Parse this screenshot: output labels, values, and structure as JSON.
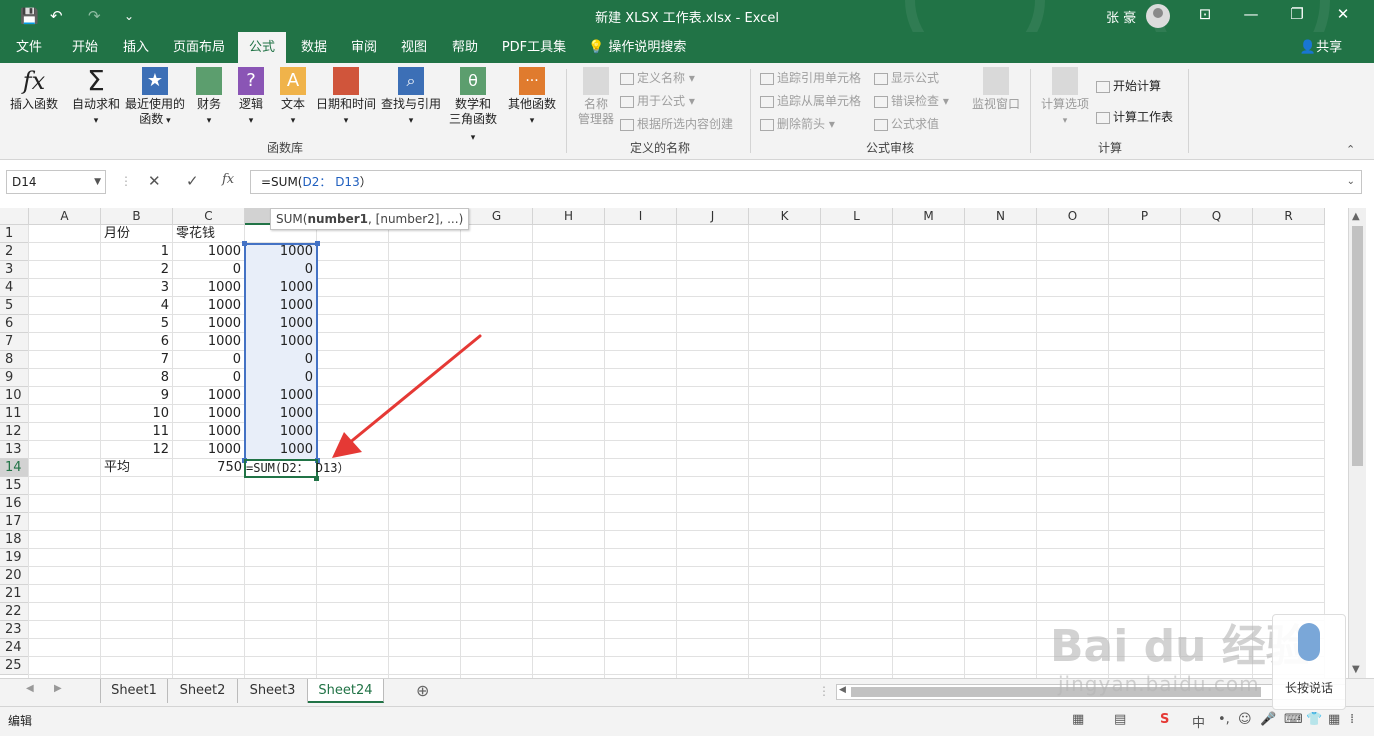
{
  "titlebar": {
    "title": "新建 XLSX 工作表.xlsx  -  Excel",
    "user": "张 豪",
    "save_icon": "💾",
    "undo_icon": "↶",
    "redo_icon": "↷",
    "customize_icon": "⌄",
    "ribbon_display_icon": "⊡",
    "minimize_icon": "—",
    "restore_icon": "❐",
    "close_icon": "✕"
  },
  "menu": {
    "tabs": [
      "文件",
      "开始",
      "插入",
      "页面布局",
      "公式",
      "数据",
      "审阅",
      "视图",
      "帮助",
      "PDF工具集"
    ],
    "active_tab": "公式",
    "search": "操作说明搜索",
    "share": "共享"
  },
  "ribbon": {
    "function_library": {
      "insert_function": "插入函数",
      "autosum": "自动求和",
      "recently_used_1": "最近使用的",
      "recently_used_2": "函数",
      "financial": "财务",
      "logical": "逻辑",
      "text": "文本",
      "datetime": "日期和时间",
      "lookup": "查找与引用",
      "math_1": "数学和",
      "math_2": "三角函数",
      "more": "其他函数",
      "group_label": "函数库"
    },
    "defined_names": {
      "name_manager_1": "名称",
      "name_manager_2": "管理器",
      "define_name": "定义名称",
      "use_in_formula": "用于公式",
      "create_from_selection": "根据所选内容创建",
      "group_label": "定义的名称"
    },
    "formula_auditing": {
      "trace_precedents": "追踪引用单元格",
      "trace_dependents": "追踪从属单元格",
      "remove_arrows": "删除箭头",
      "show_formulas": "显示公式",
      "error_checking": "错误检查",
      "evaluate_formula": "公式求值",
      "watch_window": "监视窗口",
      "group_label": "公式审核"
    },
    "calculation": {
      "options": "计算选项",
      "calc_now": "开始计算",
      "calc_sheet": "计算工作表",
      "group_label": "计算"
    }
  },
  "formula_bar": {
    "name_box": "D14",
    "cancel_icon": "✕",
    "enter_icon": "✓",
    "fx_icon": "fx",
    "formula_prefix": "=SUM(",
    "formula_ref": "D2： D13",
    "formula_suffix": "）"
  },
  "sheet": {
    "columns": [
      "A",
      "B",
      "C",
      "D",
      "E",
      "F",
      "G",
      "H",
      "I",
      "J",
      "K",
      "L",
      "M",
      "N",
      "O",
      "P",
      "Q",
      "R"
    ],
    "row_numbers": [
      "1",
      "2",
      "3",
      "4",
      "5",
      "6",
      "7",
      "8",
      "9",
      "10",
      "11",
      "12",
      "13",
      "14",
      "15",
      "16",
      "17",
      "18",
      "19",
      "20",
      "21",
      "22",
      "23",
      "24",
      "25"
    ],
    "header_b": "月份",
    "header_c": "零花钱",
    "rows": [
      {
        "b": "1",
        "c": "1000",
        "d": "1000"
      },
      {
        "b": "2",
        "c": "0",
        "d": "0"
      },
      {
        "b": "3",
        "c": "1000",
        "d": "1000"
      },
      {
        "b": "4",
        "c": "1000",
        "d": "1000"
      },
      {
        "b": "5",
        "c": "1000",
        "d": "1000"
      },
      {
        "b": "6",
        "c": "1000",
        "d": "1000"
      },
      {
        "b": "7",
        "c": "0",
        "d": "0"
      },
      {
        "b": "8",
        "c": "0",
        "d": "0"
      },
      {
        "b": "9",
        "c": "1000",
        "d": "1000"
      },
      {
        "b": "10",
        "c": "1000",
        "d": "1000"
      },
      {
        "b": "11",
        "c": "1000",
        "d": "1000"
      },
      {
        "b": "12",
        "c": "1000",
        "d": "1000"
      }
    ],
    "avg_label": "平均",
    "avg_value": "750",
    "editing_formula": "=SUM(D2： D13）",
    "tooltip_prefix": "SUM(",
    "tooltip_bold": "number1",
    "tooltip_rest": ", [number2], ...)"
  },
  "sheet_tabs": [
    "Sheet1",
    "Sheet2",
    "Sheet3",
    "Sheet24"
  ],
  "active_sheet": "Sheet24",
  "add_sheet_icon": "⊕",
  "status": {
    "mode": "编辑"
  },
  "watermark": {
    "brand": "Bai du 经验",
    "url": "jingyan.baidu.com",
    "voice_label": "长按说话"
  },
  "colors": {
    "excel_green": "#217346",
    "selection_blue": "#4472c4",
    "annotation_red": "#e53935"
  }
}
